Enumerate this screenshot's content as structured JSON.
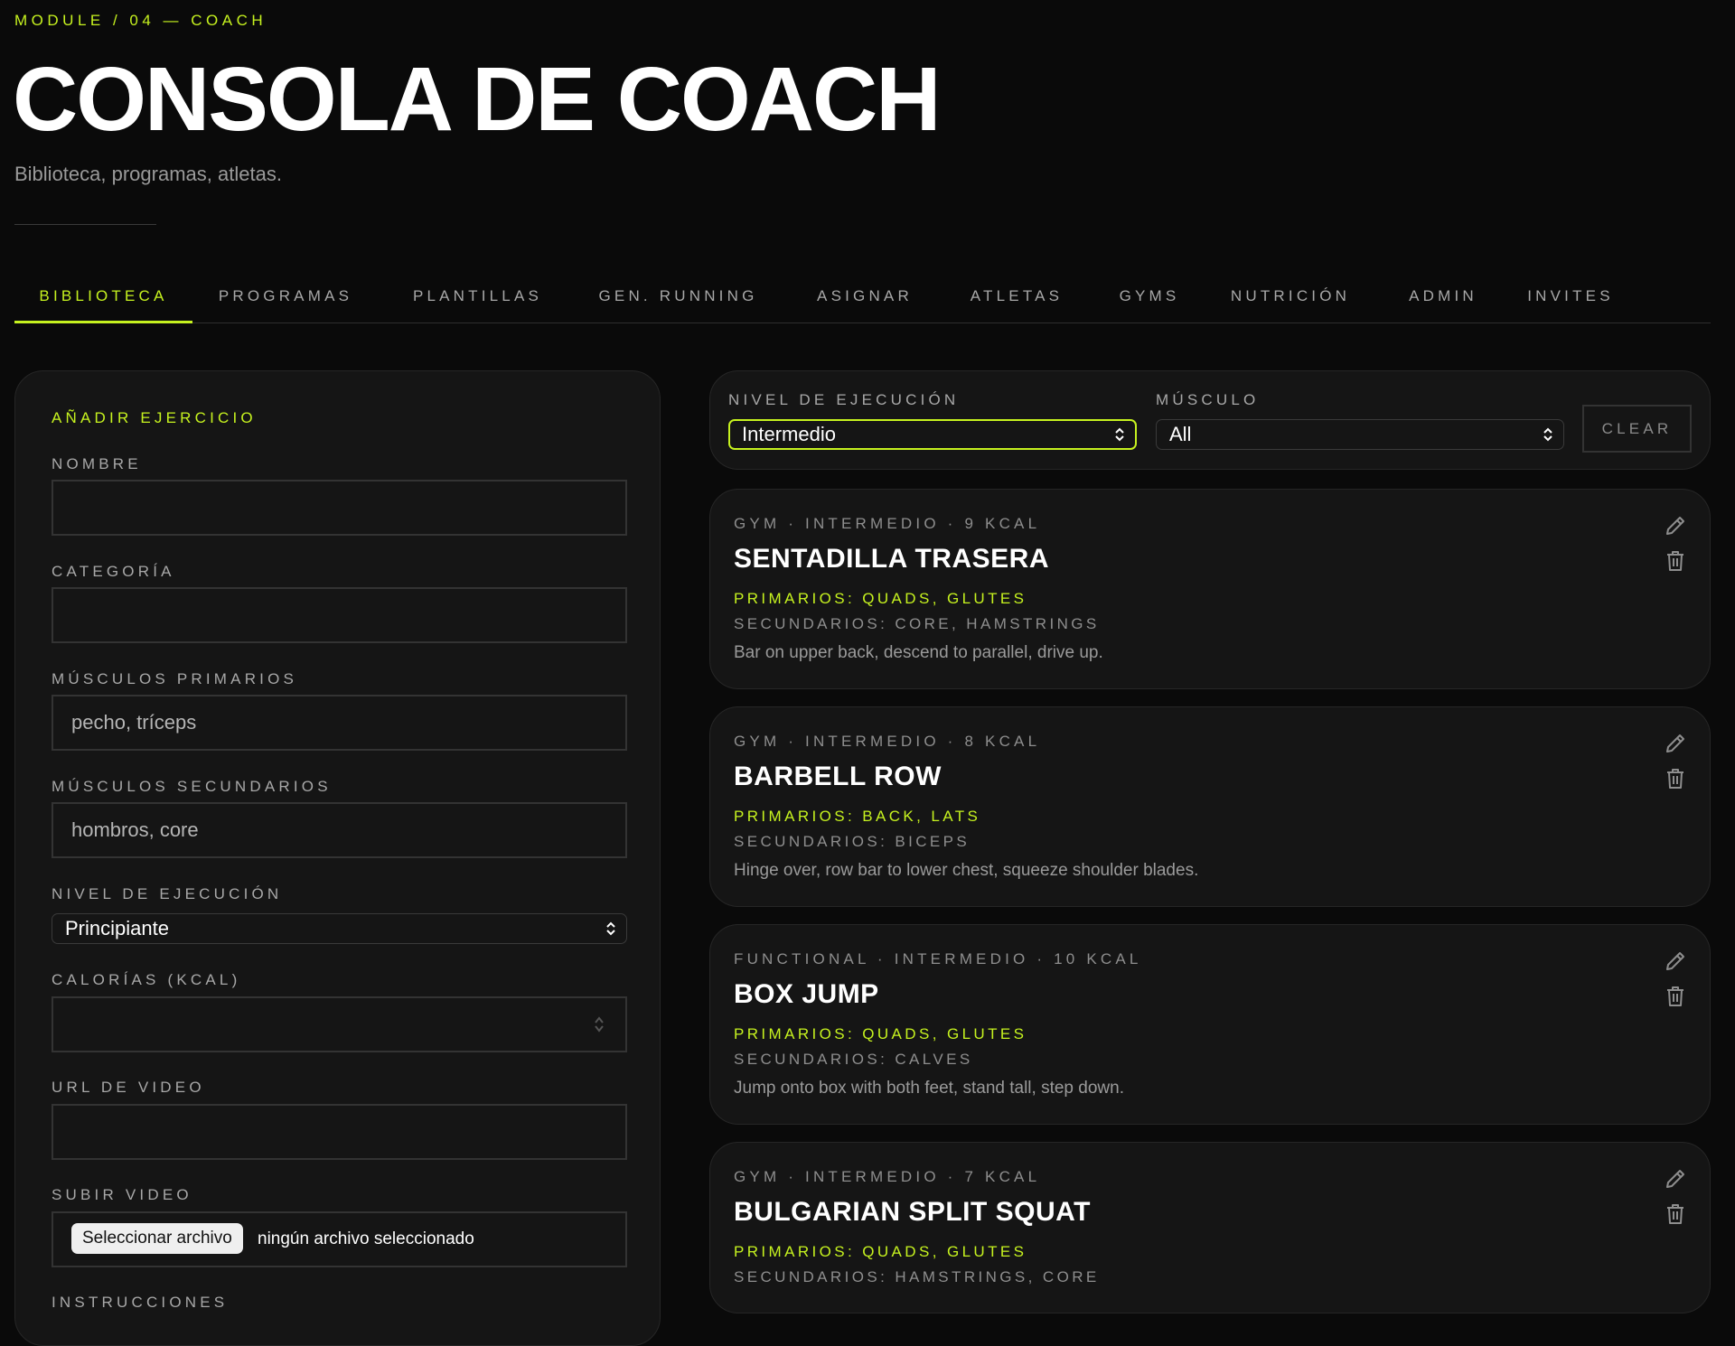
{
  "header": {
    "kicker": "MODULE / 04 — COACH",
    "title": "CONSOLA DE COACH",
    "subtitle": "Biblioteca, programas, atletas."
  },
  "tabs": [
    {
      "label": "BIBLIOTECA",
      "active": true
    },
    {
      "label": "PROGRAMAS",
      "active": false
    },
    {
      "label": "PLANTILLAS",
      "active": false
    },
    {
      "label": "GEN. RUNNING",
      "active": false
    },
    {
      "label": "ASIGNAR",
      "active": false
    },
    {
      "label": "ATLETAS",
      "active": false
    },
    {
      "label": "GYMS",
      "active": false
    },
    {
      "label": "NUTRICIÓN",
      "active": false
    },
    {
      "label": "ADMIN",
      "active": false
    },
    {
      "label": "INVITES",
      "active": false
    }
  ],
  "form": {
    "heading": "AÑADIR EJERCICIO",
    "nombre_label": "NOMBRE",
    "nombre_value": "",
    "categoria_label": "CATEGORÍA",
    "categoria_value": "",
    "primarios_label": "MÚSCULOS PRIMARIOS",
    "primarios_placeholder": "pecho, tríceps",
    "secundarios_label": "MÚSCULOS SECUNDARIOS",
    "secundarios_placeholder": "hombros, core",
    "nivel_label": "NIVEL DE EJECUCIÓN",
    "nivel_value": "Principiante",
    "calorias_label": "CALORÍAS (KCAL)",
    "calorias_value": "",
    "url_label": "URL DE VIDEO",
    "url_value": "",
    "subir_label": "SUBIR VIDEO",
    "file_button": "Seleccionar archivo",
    "file_status": "ningún archivo seleccionado",
    "instrucciones_label": "INSTRUCCIONES"
  },
  "filters": {
    "nivel_label": "NIVEL DE EJECUCIÓN",
    "nivel_value": "Intermedio",
    "musculo_label": "MÚSCULO",
    "musculo_value": "All",
    "clear_label": "CLEAR"
  },
  "exercises": [
    {
      "meta": "GYM · INTERMEDIO · 9 KCAL",
      "name": "SENTADILLA TRASERA",
      "primary": "PRIMARIOS: QUADS, GLUTES",
      "secondary": "SECUNDARIOS: CORE, HAMSTRINGS",
      "description": "Bar on upper back, descend to parallel, drive up."
    },
    {
      "meta": "GYM · INTERMEDIO · 8 KCAL",
      "name": "BARBELL ROW",
      "primary": "PRIMARIOS: BACK, LATS",
      "secondary": "SECUNDARIOS: BICEPS",
      "description": "Hinge over, row bar to lower chest, squeeze shoulder blades."
    },
    {
      "meta": "FUNCTIONAL · INTERMEDIO · 10 KCAL",
      "name": "BOX JUMP",
      "primary": "PRIMARIOS: QUADS, GLUTES",
      "secondary": "SECUNDARIOS: CALVES",
      "description": "Jump onto box with both feet, stand tall, step down."
    },
    {
      "meta": "GYM · INTERMEDIO · 7 KCAL",
      "name": "BULGARIAN SPLIT SQUAT",
      "primary": "PRIMARIOS: QUADS, GLUTES",
      "secondary": "SECUNDARIOS: HAMSTRINGS, CORE",
      "description": ""
    }
  ],
  "colors": {
    "accent": "#c6f21f",
    "background": "#0a0a0a",
    "card": "#151515"
  },
  "icons": [
    "pencil-icon",
    "trash-icon",
    "chevron-updown-icon"
  ]
}
